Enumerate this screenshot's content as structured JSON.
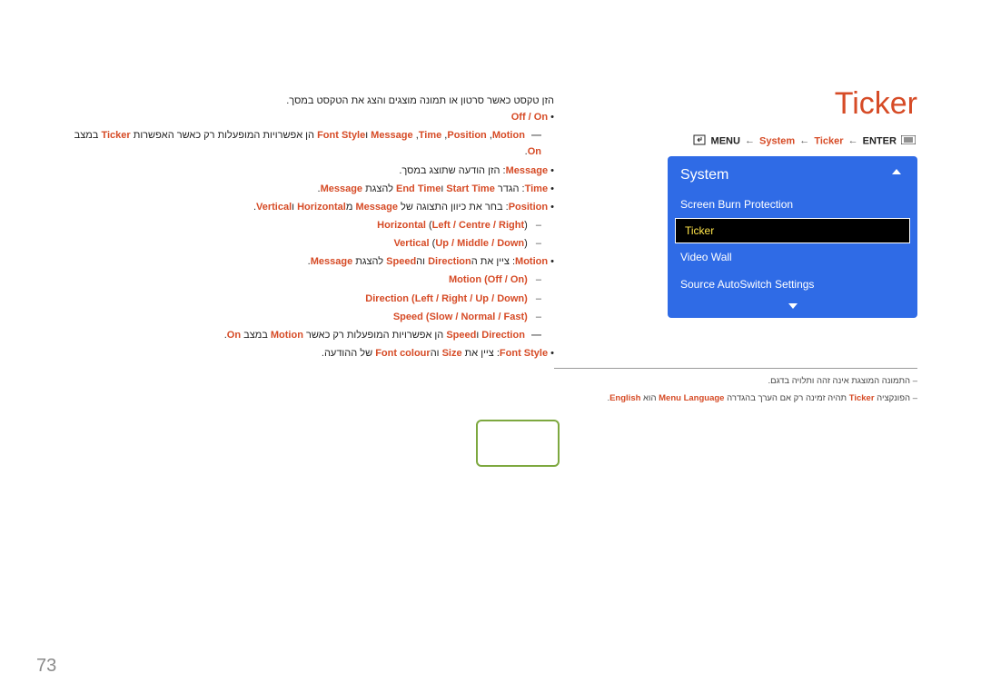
{
  "title": "Ticker",
  "breadcrumb": {
    "menu": "MENU",
    "system": "System",
    "ticker": "Ticker",
    "enter": "ENTER"
  },
  "menu": {
    "header": "System",
    "items": [
      {
        "label": "Screen Burn Protection",
        "selected": false
      },
      {
        "label": "Ticker",
        "selected": true
      },
      {
        "label": "Video Wall",
        "selected": false
      },
      {
        "label": "Source AutoSwitch Settings",
        "selected": false
      }
    ]
  },
  "notes": {
    "line1": "התמונה המוצגת אינה זהה ותלויה בדגם.",
    "line2_pre": "הפונקציה ",
    "line2_ticker": "Ticker",
    "line2_mid": " תהיה זמינה רק אם הערך בהגדרה ",
    "line2_ml": "Menu Language",
    "line2_mid2": " הוא ",
    "line2_en": "English",
    "line2_end": "."
  },
  "content": {
    "intro": "הזן טקסט כאשר סרטון או תמונה מוצגים והצג את הטקסט במסך.",
    "onoff_on": "On",
    "onoff_sep": " / ",
    "onoff_off": "Off",
    "l2_pre": "",
    "l2_msg": "Message",
    "l2_c1": " ,",
    "l2_time": "Time",
    "l2_c2": " ,",
    "l2_pos": "Position",
    "l2_c3": " ,",
    "l2_motion": "Motion",
    "l2_and": " ו",
    "l2_fs": "Font Style",
    "l2_mid": " הן אפשרויות המופעלות רק כאשר האפשרות ",
    "l2_ticker": "Ticker",
    "l2_state": " במצב ",
    "l2_on": "On",
    "l2_end": ".",
    "msg_label": "Message",
    "msg_text": ": הזן הודעה שתוצג במסך.",
    "time_label": "Time",
    "time_text1": ": הגדר ",
    "time_st": "Start Time",
    "time_and": " ו",
    "time_et": "End Time",
    "time_text2": " להצגת ",
    "time_msg": "Message",
    "time_end": ".",
    "pos_label": "Position",
    "pos_text1": ": בחר את כיוון התצוגה של ",
    "pos_msg": "Message",
    "pos_from": " מ",
    "pos_h": "Horizontal",
    "pos_and": " ו",
    "pos_v": "Vertical",
    "pos_end": ".",
    "hz_label": "Horizontal",
    "hz_opts_l": "Left",
    "hz_sep1": " / ",
    "hz_opts_c": "Centre",
    "hz_sep2": " / ",
    "hz_opts_r": "Right",
    "vt_label": "Vertical",
    "vt_opts_u": "Up",
    "vt_sep1": " / ",
    "vt_opts_m": "Middle",
    "vt_sep2": " / ",
    "vt_opts_d": "Down",
    "mo_label": "Motion",
    "mo_text1": ": ציין את ה",
    "mo_dir": "Direction",
    "mo_and": " וה",
    "mo_spd": "Speed",
    "mo_text2": " להצגת ",
    "mo_msg": "Message",
    "mo_end": ".",
    "mo2_label": "Motion",
    "mo2_open": " (",
    "mo2_off": "Off",
    "mo2_sep": " / ",
    "mo2_on": "On",
    "mo2_close": ")",
    "dir_label": "Direction",
    "dir_open": " (",
    "dir_l": "Left",
    "dir_s1": " / ",
    "dir_r": "Right",
    "dir_s2": " / ",
    "dir_u": "Up",
    "dir_s3": " / ",
    "dir_d": "Down",
    "dir_close": ")",
    "spd_label": "Speed",
    "spd_open": " (",
    "spd_s": "Slow",
    "spd_s1": " / ",
    "spd_n": "Normal",
    "spd_s2": " / ",
    "spd_f": "Fast",
    "spd_close": ")",
    "ds_dir": "Direction",
    "ds_and": " ו",
    "ds_spd": "Speed",
    "ds_text": " הן אפשרויות המופעלות רק כאשר ",
    "ds_mo": "Motion",
    "ds_state": " במצב ",
    "ds_on": "On",
    "ds_end": ".",
    "fs_label": "Font Style",
    "fs_text1": ": ציין את ",
    "fs_size": "Size",
    "fs_and": " וה",
    "fs_fc": "Font colour",
    "fs_text2": " של ההודעה."
  },
  "page_number": "73"
}
